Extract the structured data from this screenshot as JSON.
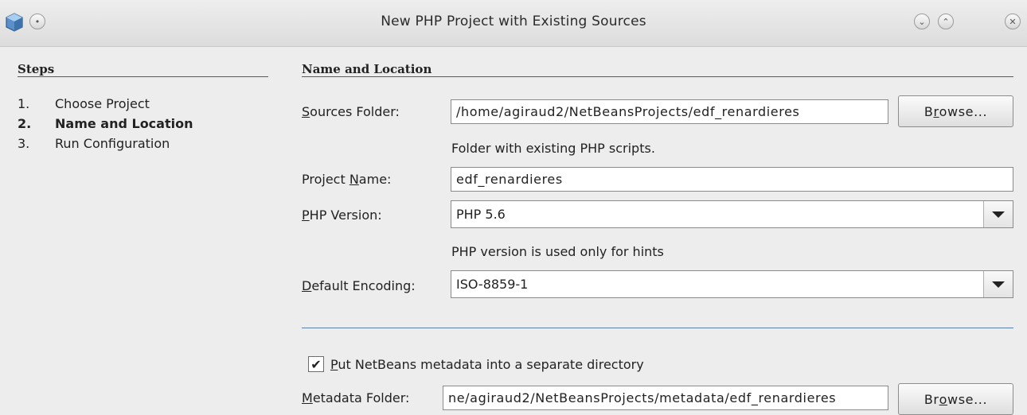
{
  "window": {
    "title": "New PHP Project with Existing Sources"
  },
  "steps": {
    "heading": "Steps",
    "items": [
      {
        "num": "1.",
        "label": "Choose Project",
        "current": false
      },
      {
        "num": "2.",
        "label": "Name and Location",
        "current": true
      },
      {
        "num": "3.",
        "label": "Run Configuration",
        "current": false
      }
    ]
  },
  "section": {
    "heading": "Name and Location"
  },
  "sources": {
    "label_mnemonic": "S",
    "label_rest": "ources Folder:",
    "value": "/home/agiraud2/NetBeansProjects/edf_renardieres",
    "hint": "Folder with existing PHP scripts.",
    "browse_pre": "B",
    "browse_mnemonic": "r",
    "browse_post": "owse..."
  },
  "project_name": {
    "label_pre": "Project ",
    "label_mnemonic": "N",
    "label_post": "ame:",
    "value": "edf_renardieres"
  },
  "php_version": {
    "label_mnemonic": "P",
    "label_rest": "HP Version:",
    "value": "PHP 5.6",
    "hint": "PHP version is used only for hints"
  },
  "encoding": {
    "label_mnemonic": "D",
    "label_rest": "efault Encoding:",
    "value": "ISO-8859-1"
  },
  "metadata": {
    "checkbox_checked": true,
    "checkbox_mnemonic": "P",
    "checkbox_rest": "ut NetBeans metadata into a separate directory",
    "label_mnemonic": "M",
    "label_rest": "etadata Folder:",
    "value": "ne/agiraud2/NetBeansProjects/metadata/edf_renardieres",
    "browse_pre": "Br",
    "browse_mnemonic": "o",
    "browse_post": "wse..."
  }
}
